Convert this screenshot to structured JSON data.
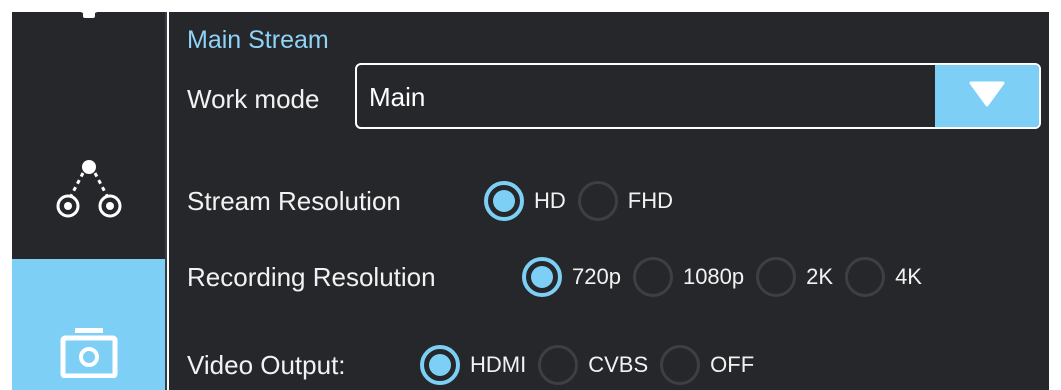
{
  "colors": {
    "accent": "#7dcff5",
    "panel_background": "#25272b",
    "text": "#f2f2f2",
    "title": "#8fd3f7"
  },
  "sidebar": {
    "items": [
      {
        "name": "settings",
        "icon": "gear-icon",
        "selected": false
      },
      {
        "name": "network",
        "icon": "network-nodes-icon",
        "selected": false
      },
      {
        "name": "camera",
        "icon": "camera-icon",
        "selected": true
      }
    ]
  },
  "main": {
    "section_title": "Main Stream",
    "work_mode": {
      "label": "Work mode",
      "value": "Main",
      "dropdown_icon": "triangle-down-icon"
    },
    "stream_resolution": {
      "label": "Stream Resolution",
      "options": [
        "HD",
        "FHD"
      ],
      "selected": "HD"
    },
    "recording_resolution": {
      "label": "Recording Resolution",
      "options": [
        "720p",
        "1080p",
        "2K",
        "4K"
      ],
      "selected": "720p"
    },
    "video_output": {
      "label": "Video Output:",
      "options": [
        "HDMI",
        "CVBS",
        "OFF"
      ],
      "selected": "HDMI"
    }
  }
}
